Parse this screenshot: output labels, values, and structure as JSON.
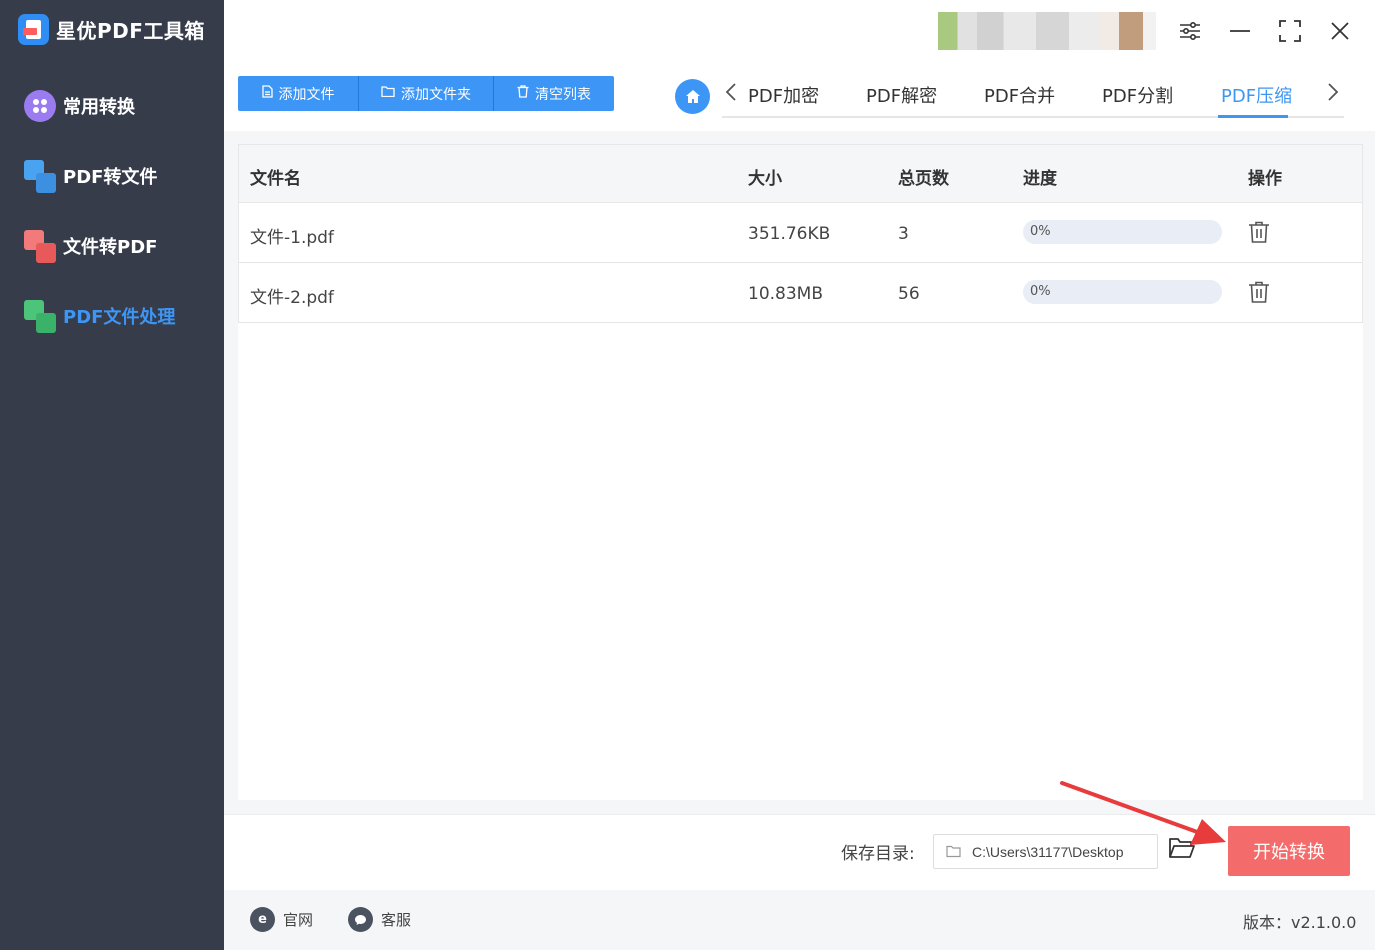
{
  "app": {
    "title": "星优PDF工具箱"
  },
  "sidebar": {
    "items": [
      {
        "label": "常用转换"
      },
      {
        "label": "PDF转文件"
      },
      {
        "label": "文件转PDF"
      },
      {
        "label": "PDF文件处理"
      }
    ]
  },
  "toolbar": {
    "add_file": "添加文件",
    "add_folder": "添加文件夹",
    "clear_list": "清空列表"
  },
  "tabs": [
    {
      "label": "PDF加密"
    },
    {
      "label": "PDF解密"
    },
    {
      "label": "PDF合并"
    },
    {
      "label": "PDF分割"
    },
    {
      "label": "PDF压缩"
    }
  ],
  "table": {
    "columns": {
      "name": "文件名",
      "size": "大小",
      "pages": "总页数",
      "progress": "进度",
      "action": "操作"
    },
    "rows": [
      {
        "name": "文件-1.pdf",
        "size": "351.76KB",
        "pages": "3",
        "progress": "0%"
      },
      {
        "name": "文件-2.pdf",
        "size": "10.83MB",
        "pages": "56",
        "progress": "0%"
      }
    ]
  },
  "bottom": {
    "save_label": "保存目录:",
    "save_path": "C:\\Users\\31177\\Desktop",
    "start_button": "开始转换"
  },
  "footer": {
    "website": "官网",
    "support": "客服",
    "version": "版本：v2.1.0.0"
  },
  "colors": {
    "sidebar_bg": "#363c49",
    "accent": "#3d96f5",
    "start_button": "#f46b6b"
  }
}
